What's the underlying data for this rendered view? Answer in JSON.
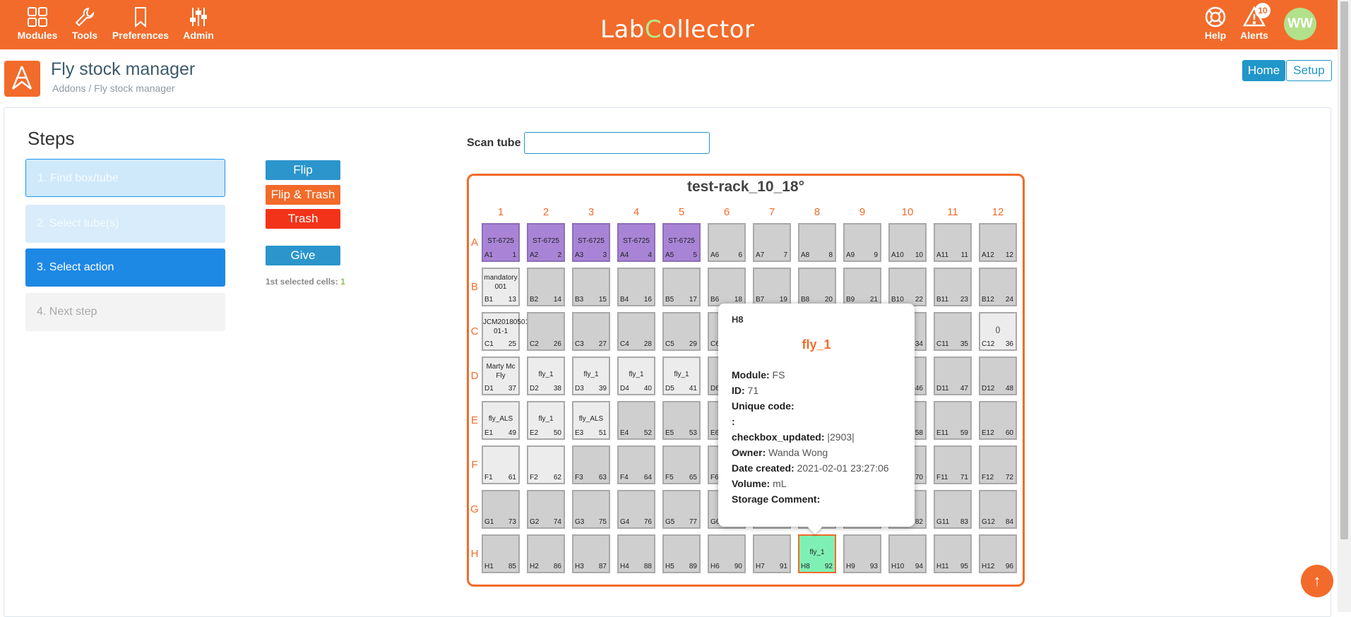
{
  "nav": {
    "modules": "Modules",
    "tools": "Tools",
    "preferences": "Preferences",
    "admin": "Admin",
    "help": "Help",
    "alerts": "Alerts",
    "alerts_count": "10",
    "avatar": "WW"
  },
  "logo": {
    "part1": "Lab",
    "part2": "C",
    "part3": "ollector"
  },
  "header": {
    "title": "Fly stock manager",
    "breadcrumb": "Addons / Fly stock manager",
    "home": "Home",
    "setup": "Setup"
  },
  "steps": {
    "title": "Steps",
    "items": [
      "1. Find box/tube",
      "2. Select tube(s)",
      "3. Select action",
      "4. Next step"
    ]
  },
  "actions": {
    "flip": "Flip",
    "flip_trash": "Flip & Trash",
    "trash": "Trash",
    "give": "Give",
    "selected_label": "1st selected cells: ",
    "selected_count": "1"
  },
  "scan": {
    "label": "Scan tube",
    "value": ""
  },
  "rack": {
    "title": "test-rack_10_18°",
    "columns": [
      "1",
      "2",
      "3",
      "4",
      "5",
      "6",
      "7",
      "8",
      "9",
      "10",
      "11",
      "12"
    ],
    "rows": [
      "A",
      "B",
      "C",
      "D",
      "E",
      "F",
      "G",
      "H"
    ],
    "cells": {
      "A1": {
        "label": "ST-6725",
        "state": "purple"
      },
      "A2": {
        "label": "ST-6725",
        "state": "purple"
      },
      "A3": {
        "label": "ST-6725",
        "state": "purple"
      },
      "A4": {
        "label": "ST-6725",
        "state": "purple"
      },
      "A5": {
        "label": "ST-6725",
        "state": "purple"
      },
      "B1": {
        "label": "mandatory 001",
        "state": "light"
      },
      "C1": {
        "label": "JCM20180501-01-1",
        "state": "light"
      },
      "C12": {
        "label": "()",
        "state": "light"
      },
      "D1": {
        "label": "Marty Mc Fly",
        "state": "light"
      },
      "D2": {
        "label": "fly_1",
        "state": "light"
      },
      "D3": {
        "label": "fly_1",
        "state": "light"
      },
      "D4": {
        "label": "fly_1",
        "state": "light"
      },
      "D5": {
        "label": "fly_1",
        "state": "light"
      },
      "E1": {
        "label": "fly_ALS",
        "state": "light"
      },
      "E2": {
        "label": "fly_1",
        "state": "light"
      },
      "E3": {
        "label": "fly_ALS",
        "state": "light"
      },
      "F1": {
        "label": "",
        "state": "light"
      },
      "F2": {
        "label": "",
        "state": "light"
      },
      "H8": {
        "label": "fly_1",
        "state": "selected"
      }
    }
  },
  "popover": {
    "position": "H8",
    "name": "fly_1",
    "fields": [
      {
        "label": "Module:",
        "value": "FS"
      },
      {
        "label": "ID:",
        "value": "71"
      },
      {
        "label": "Unique code:",
        "value": ""
      },
      {
        "label": ":",
        "value": ""
      },
      {
        "label": "checkbox_updated:",
        "value": "|2903|"
      },
      {
        "label": "Owner:",
        "value": "Wanda Wong"
      },
      {
        "label": "Date created:",
        "value": "2021-02-01 23:27:06"
      },
      {
        "label": "Volume:",
        "value": "mL"
      },
      {
        "label": "Storage Comment:",
        "value": ""
      }
    ]
  },
  "colors": {
    "brand": "#f26b2a",
    "primary": "#2196c9",
    "active_step": "#1e88e5"
  }
}
